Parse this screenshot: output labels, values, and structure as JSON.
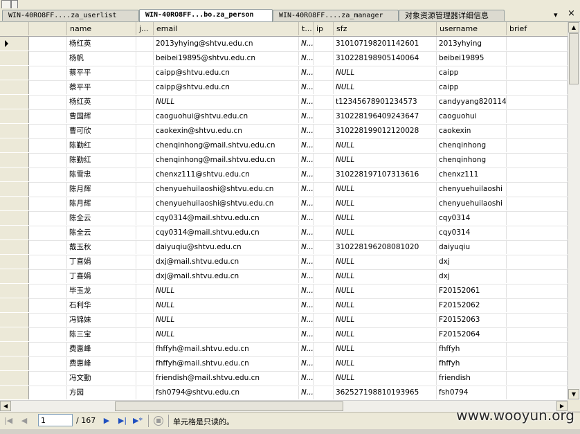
{
  "tabs": [
    {
      "label": "WIN-40RO8FF....za_userlist",
      "active": false
    },
    {
      "label": "WIN-40RO8FF...bo.za_person",
      "active": true
    },
    {
      "label": "WIN-40RO8FF....za_manager",
      "active": false
    },
    {
      "label": "对象资源管理器详细信息",
      "active": false
    }
  ],
  "tab_controls": {
    "dropdown": "▾",
    "close": "×"
  },
  "columns": [
    "",
    "name",
    "j...",
    "email",
    "t...",
    "ip",
    "sfz",
    "username",
    "brief"
  ],
  "rows": [
    {
      "name": "杨红英",
      "j": "",
      "email": "2013yhying@shtvu.edu.cn",
      "t": "N...",
      "ip": "",
      "sfz": "310107198201142601",
      "username": "2013yhying",
      "brief": ""
    },
    {
      "name": "杨帆",
      "j": "",
      "email": "beibei19895@shtvu.edu.cn",
      "t": "N...",
      "ip": "",
      "sfz": "310228198905140064",
      "username": "beibei19895",
      "brief": ""
    },
    {
      "name": "蔡平平",
      "j": "",
      "email": "caipp@shtvu.edu.cn",
      "t": "N...",
      "ip": "",
      "sfz": "NULL",
      "username": "caipp",
      "brief": ""
    },
    {
      "name": "蔡平平",
      "j": "",
      "email": "caipp@shtvu.edu.cn",
      "t": "N...",
      "ip": "",
      "sfz": "NULL",
      "username": "caipp",
      "brief": ""
    },
    {
      "name": "杨红英",
      "j": "",
      "email": "NULL",
      "t": "N...",
      "ip": "",
      "sfz": "t12345678901234573",
      "username": "candyyang820114",
      "brief": ""
    },
    {
      "name": "曹国辉",
      "j": "",
      "email": "caoguohui@shtvu.edu.cn",
      "t": "N...",
      "ip": "",
      "sfz": "310228196409243647",
      "username": "caoguohui",
      "brief": ""
    },
    {
      "name": "曹可欣",
      "j": "",
      "email": "caokexin@shtvu.edu.cn",
      "t": "N...",
      "ip": "",
      "sfz": "310228199012120028",
      "username": "caokexin",
      "brief": ""
    },
    {
      "name": "陈勤红",
      "j": "",
      "email": "chenqinhong@mail.shtvu.edu.cn",
      "t": "N...",
      "ip": "",
      "sfz": "NULL",
      "username": "chenqinhong",
      "brief": ""
    },
    {
      "name": "陈勤红",
      "j": "",
      "email": "chenqinhong@mail.shtvu.edu.cn",
      "t": "N...",
      "ip": "",
      "sfz": "NULL",
      "username": "chenqinhong",
      "brief": ""
    },
    {
      "name": "陈雪忠",
      "j": "",
      "email": "chenxz111@shtvu.edu.cn",
      "t": "N...",
      "ip": "",
      "sfz": "310228197107313616",
      "username": "chenxz111",
      "brief": ""
    },
    {
      "name": "陈月辉",
      "j": "",
      "email": "chenyuehuilaoshi@shtvu.edu.cn",
      "t": "N...",
      "ip": "",
      "sfz": "NULL",
      "username": "chenyuehuilaoshi",
      "brief": ""
    },
    {
      "name": "陈月辉",
      "j": "",
      "email": "chenyuehuilaoshi@shtvu.edu.cn",
      "t": "N...",
      "ip": "",
      "sfz": "NULL",
      "username": "chenyuehuilaoshi",
      "brief": ""
    },
    {
      "name": "陈全云",
      "j": "",
      "email": "cqy0314@mail.shtvu.edu.cn",
      "t": "N...",
      "ip": "",
      "sfz": "NULL",
      "username": "cqy0314",
      "brief": ""
    },
    {
      "name": "陈全云",
      "j": "",
      "email": "cqy0314@mail.shtvu.edu.cn",
      "t": "N...",
      "ip": "",
      "sfz": "NULL",
      "username": "cqy0314",
      "brief": ""
    },
    {
      "name": "戴玉秋",
      "j": "",
      "email": "daiyuqiu@shtvu.edu.cn",
      "t": "N...",
      "ip": "",
      "sfz": "310228196208081020",
      "username": "daiyuqiu",
      "brief": ""
    },
    {
      "name": "丁喜娟",
      "j": "",
      "email": "dxj@mail.shtvu.edu.cn",
      "t": "N...",
      "ip": "",
      "sfz": "NULL",
      "username": "dxj",
      "brief": ""
    },
    {
      "name": "丁喜娟",
      "j": "",
      "email": "dxj@mail.shtvu.edu.cn",
      "t": "N...",
      "ip": "",
      "sfz": "NULL",
      "username": "dxj",
      "brief": ""
    },
    {
      "name": "毕玉龙",
      "j": "",
      "email": "NULL",
      "t": "N...",
      "ip": "",
      "sfz": "NULL",
      "username": "F20152061",
      "brief": ""
    },
    {
      "name": "石利华",
      "j": "",
      "email": "NULL",
      "t": "N...",
      "ip": "",
      "sfz": "NULL",
      "username": "F20152062",
      "brief": ""
    },
    {
      "name": "冯锦妹",
      "j": "",
      "email": "NULL",
      "t": "N...",
      "ip": "",
      "sfz": "NULL",
      "username": "F20152063",
      "brief": ""
    },
    {
      "name": "陈三宝",
      "j": "",
      "email": "NULL",
      "t": "N...",
      "ip": "",
      "sfz": "NULL",
      "username": "F20152064",
      "brief": ""
    },
    {
      "name": "费惠峰",
      "j": "",
      "email": "fhffyh@mail.shtvu.edu.cn",
      "t": "N...",
      "ip": "",
      "sfz": "NULL",
      "username": "fhffyh",
      "brief": ""
    },
    {
      "name": "费惠峰",
      "j": "",
      "email": "fhffyh@mail.shtvu.edu.cn",
      "t": "N...",
      "ip": "",
      "sfz": "NULL",
      "username": "fhffyh",
      "brief": ""
    },
    {
      "name": "冯文勤",
      "j": "",
      "email": "friendish@mail.shtvu.edu.cn",
      "t": "N...",
      "ip": "",
      "sfz": "NULL",
      "username": "friendish",
      "brief": ""
    },
    {
      "name": "方园",
      "j": "",
      "email": "fsh0794@shtvu.edu.cn",
      "t": "N...",
      "ip": "",
      "sfz": "362527198810193965",
      "username": "fsh0794",
      "brief": ""
    }
  ],
  "navigation": {
    "current_page": "1",
    "total": "/ 167",
    "status": "单元格是只读的。"
  },
  "watermark": "www.wooyun.org",
  "colors": {
    "header_bg": "#ece9d8",
    "grid_bg": "#ffffff",
    "nav_icon": "#2050c0"
  }
}
